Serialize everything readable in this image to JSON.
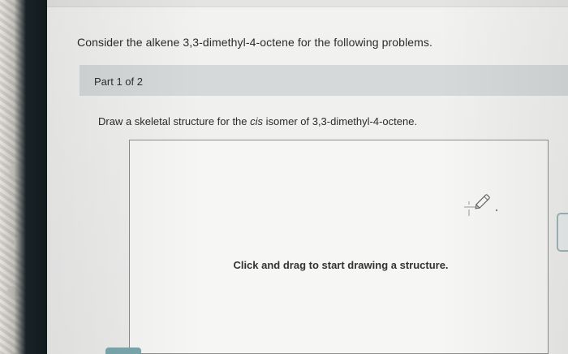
{
  "question": {
    "intro": "Consider the alkene 3,3-dimethyl-4-octene for the following problems."
  },
  "part": {
    "label": "Part 1 of 2"
  },
  "task": {
    "prefix": "Draw a skeletal structure for the ",
    "emphasis": "cis",
    "suffix": " isomer of 3,3-dimethyl-4-octene."
  },
  "canvas": {
    "hint": "Click and drag to start drawing a structure.",
    "tool_icon": "pencil-crosshair-icon"
  },
  "colors": {
    "part_bar": "#d6d9d9",
    "button_accent": "#7aa7ad",
    "tab_border": "#9fb3b6"
  }
}
